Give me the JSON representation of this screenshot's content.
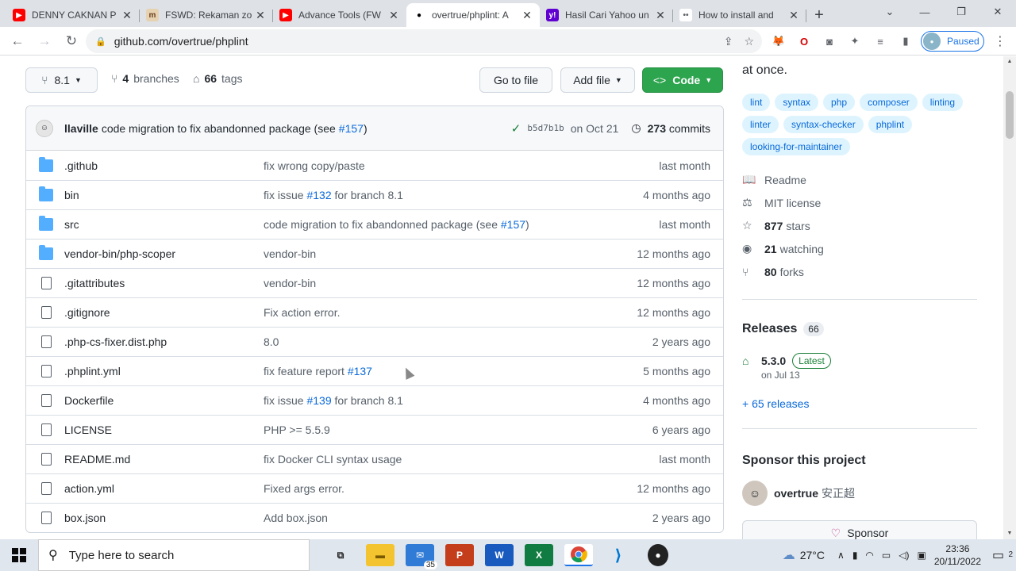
{
  "browser": {
    "tabs": [
      {
        "title": "DENNY CAKNAN P",
        "fav": "▶",
        "fav_bg": "#ff0000",
        "fav_fg": "#fff"
      },
      {
        "title": "FSWD: Rekaman zo",
        "fav": "m",
        "fav_bg": "#e6d2b0",
        "fav_fg": "#6b3f1f"
      },
      {
        "title": "Advance Tools (FW",
        "fav": "▶",
        "fav_bg": "#ff0000",
        "fav_fg": "#fff"
      },
      {
        "title": "overtrue/phplint: A",
        "fav": "●",
        "fav_bg": "#ffffff",
        "fav_fg": "#000"
      },
      {
        "title": "Hasil Cari Yahoo un",
        "fav": "y!",
        "fav_bg": "#6001d2",
        "fav_fg": "#fff"
      },
      {
        "title": "How to install and",
        "fav": "••",
        "fav_bg": "#ffffff",
        "fav_fg": "#5f6368"
      }
    ],
    "url": "github.com/overtrue/phplint",
    "profile_status": "Paused"
  },
  "repo": {
    "branch": "8.1",
    "branches_count": "4",
    "branches_label": "branches",
    "tags_count": "66",
    "tags_label": "tags",
    "go_to_file": "Go to file",
    "add_file": "Add file",
    "code": "Code"
  },
  "commit": {
    "author": "llaville",
    "message": "code migration to fix abandonned package (see",
    "issue": "#157",
    "close": ")",
    "sha": "b5d7b1b",
    "date": "on Oct 21",
    "commits_count": "273",
    "commits_label": "commits"
  },
  "files": [
    {
      "name": ".github",
      "type": "dir",
      "msg": "fix wrong copy/paste",
      "msg_link": "",
      "msg_tail": "",
      "age": "last month"
    },
    {
      "name": "bin",
      "type": "dir",
      "msg": "fix issue ",
      "msg_link": "#132",
      "msg_tail": " for branch 8.1",
      "age": "4 months ago"
    },
    {
      "name": "src",
      "type": "dir",
      "msg": "code migration to fix abandonned package (see ",
      "msg_link": "#157",
      "msg_tail": ")",
      "age": "last month"
    },
    {
      "name": "vendor-bin/php-scoper",
      "type": "dir",
      "msg": "vendor-bin",
      "msg_link": "",
      "msg_tail": "",
      "age": "12 months ago"
    },
    {
      "name": ".gitattributes",
      "type": "file",
      "msg": "vendor-bin",
      "msg_link": "",
      "msg_tail": "",
      "age": "12 months ago"
    },
    {
      "name": ".gitignore",
      "type": "file",
      "msg": "Fix action error.",
      "msg_link": "",
      "msg_tail": "",
      "age": "12 months ago"
    },
    {
      "name": ".php-cs-fixer.dist.php",
      "type": "file",
      "msg": "8.0",
      "msg_link": "",
      "msg_tail": "",
      "age": "2 years ago"
    },
    {
      "name": ".phplint.yml",
      "type": "file",
      "msg": "fix feature report ",
      "msg_link": "#137",
      "msg_tail": "",
      "age": "5 months ago"
    },
    {
      "name": "Dockerfile",
      "type": "file",
      "msg": "fix issue ",
      "msg_link": "#139",
      "msg_tail": " for branch 8.1",
      "age": "4 months ago"
    },
    {
      "name": "LICENSE",
      "type": "file",
      "msg": "PHP >= 5.5.9",
      "msg_link": "",
      "msg_tail": "",
      "age": "6 years ago"
    },
    {
      "name": "README.md",
      "type": "file",
      "msg": "fix Docker CLI syntax usage",
      "msg_link": "",
      "msg_tail": "",
      "age": "last month"
    },
    {
      "name": "action.yml",
      "type": "file",
      "msg": "Fixed args error.",
      "msg_link": "",
      "msg_tail": "",
      "age": "12 months ago"
    },
    {
      "name": "box.json",
      "type": "file",
      "msg": "Add box.json",
      "msg_link": "",
      "msg_tail": "",
      "age": "2 years ago"
    }
  ],
  "about": {
    "description_tail": "at once.",
    "topics": [
      "lint",
      "syntax",
      "php",
      "composer",
      "linting",
      "linter",
      "syntax-checker",
      "phplint",
      "looking-for-maintainer"
    ],
    "readme": "Readme",
    "license": "MIT license",
    "stars_count": "877",
    "stars_label": "stars",
    "watching_count": "21",
    "watching_label": "watching",
    "forks_count": "80",
    "forks_label": "forks"
  },
  "releases": {
    "title": "Releases",
    "count": "66",
    "latest_version": "5.3.0",
    "latest_badge": "Latest",
    "latest_date": "on Jul 13",
    "more": "+ 65 releases"
  },
  "sponsor": {
    "title": "Sponsor this project",
    "user": "overtrue",
    "user_cn": "安正超",
    "button": "Sponsor"
  },
  "taskbar": {
    "search_placeholder": "Type here to search",
    "mail_badge": "35",
    "temperature": "27°C",
    "time": "23:36",
    "date": "20/11/2022",
    "notif_count": "2"
  }
}
